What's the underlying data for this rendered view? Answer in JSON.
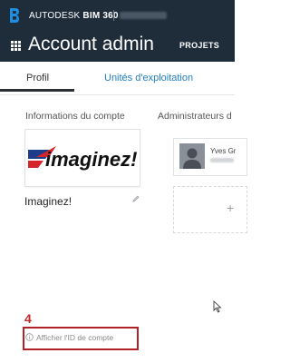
{
  "header": {
    "brand_company": "AUTODESK",
    "brand_product": "BIM 360",
    "page_title": "Account admin",
    "projects_label": "PROJETS"
  },
  "tabs": [
    {
      "label": "Profil",
      "active": true
    },
    {
      "label": "Unités d'exploitation",
      "active": false
    }
  ],
  "account_info": {
    "title": "Informations du compte",
    "company_name": "Imaginez!",
    "logo_text": "imaginez!"
  },
  "administrators": {
    "title": "Administrateurs d",
    "admin_name": "Yves Gr"
  },
  "account_id": {
    "link_label": "Afficher l'ID de compte"
  },
  "annotation": {
    "number": "4",
    "color": "#b22028"
  },
  "colors": {
    "header_bg": "#1f2c3a",
    "tab_link": "#1f7dc2",
    "logo_red": "#d4252c",
    "logo_blue": "#1d3c8c"
  }
}
